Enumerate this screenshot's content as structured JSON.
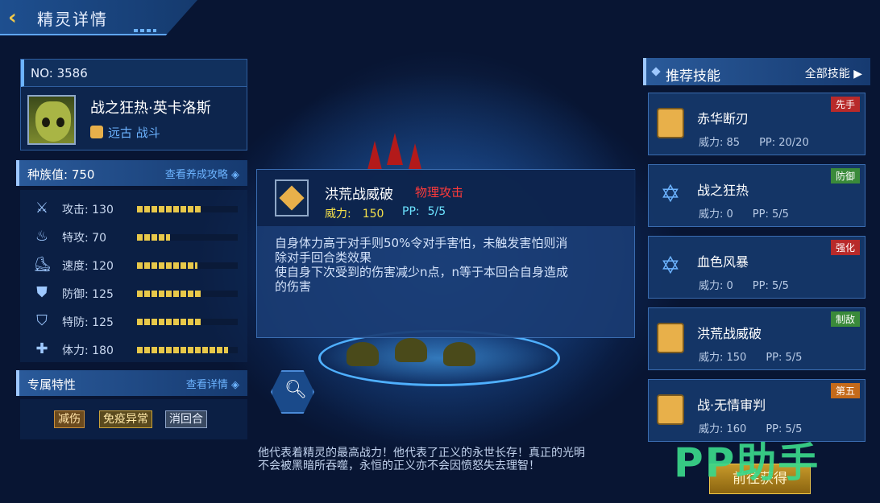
{
  "header": {
    "title": "精灵详情"
  },
  "pet": {
    "no_label": "NO:  3586",
    "name": "战之狂热·英卡洛斯",
    "attributes": "远古 战斗"
  },
  "race": {
    "label": "种族值:  750",
    "link": "查看养成攻略"
  },
  "stats": [
    {
      "label": "攻击:  130",
      "icon": "sword-icon",
      "fraction": 0.65
    },
    {
      "label": "特攻:  70",
      "icon": "flame-icon",
      "fraction": 0.33
    },
    {
      "label": "速度:  120",
      "icon": "boot-icon",
      "fraction": 0.6
    },
    {
      "label": "防御:  125",
      "icon": "shield-icon",
      "fraction": 0.63
    },
    {
      "label": "特防:  125",
      "icon": "magic-shield-icon",
      "fraction": 0.63
    },
    {
      "label": "体力:  180",
      "icon": "health-icon",
      "fraction": 0.9
    }
  ],
  "trait": {
    "label": "专属特性",
    "link": "查看详情",
    "tags": [
      "减伤",
      "免疫异常",
      "消回合"
    ]
  },
  "popup": {
    "name": "洪荒战威破",
    "type": "物理攻击",
    "power_label": "威力:",
    "power": "150",
    "pp_label": "PP:",
    "pp": "5/5",
    "description": "自身体力高于对手则50%令对手害怕，未触发害怕则消\n除对手回合类效果\n使自身下次受到的伤害减少n点，n等于本回合自身造成\n的伤害"
  },
  "flavor": "他代表着精灵的最高战力！他代表了正义的永世长存！真正的光明\n不会被黑暗所吞噬，永恒的正义亦不会因愤怒失去理智！",
  "skills_panel": {
    "title": "推荐技能",
    "all_link": "全部技能",
    "skills": [
      {
        "name": "赤华断刃",
        "power": "威力:  85",
        "pp": "PP:  20/20",
        "badge": "先手",
        "badge_color": "red",
        "icon": "scroll"
      },
      {
        "name": "战之狂热",
        "power": "威力:  0",
        "pp": "PP:  5/5",
        "badge": "防御",
        "badge_color": "green",
        "icon": "star"
      },
      {
        "name": "血色风暴",
        "power": "威力:  0",
        "pp": "PP:  5/5",
        "badge": "强化",
        "badge_color": "red",
        "icon": "star"
      },
      {
        "name": "洪荒战威破",
        "power": "威力:  150",
        "pp": "PP:  5/5",
        "badge": "制敌",
        "badge_color": "green",
        "icon": "scroll"
      },
      {
        "name": "战·无情审判",
        "power": "威力:  160",
        "pp": "PP:  5/5",
        "badge": "第五",
        "badge_color": "orange",
        "icon": "scroll"
      }
    ]
  },
  "get_button": "前往获得",
  "watermark": "PP助手"
}
